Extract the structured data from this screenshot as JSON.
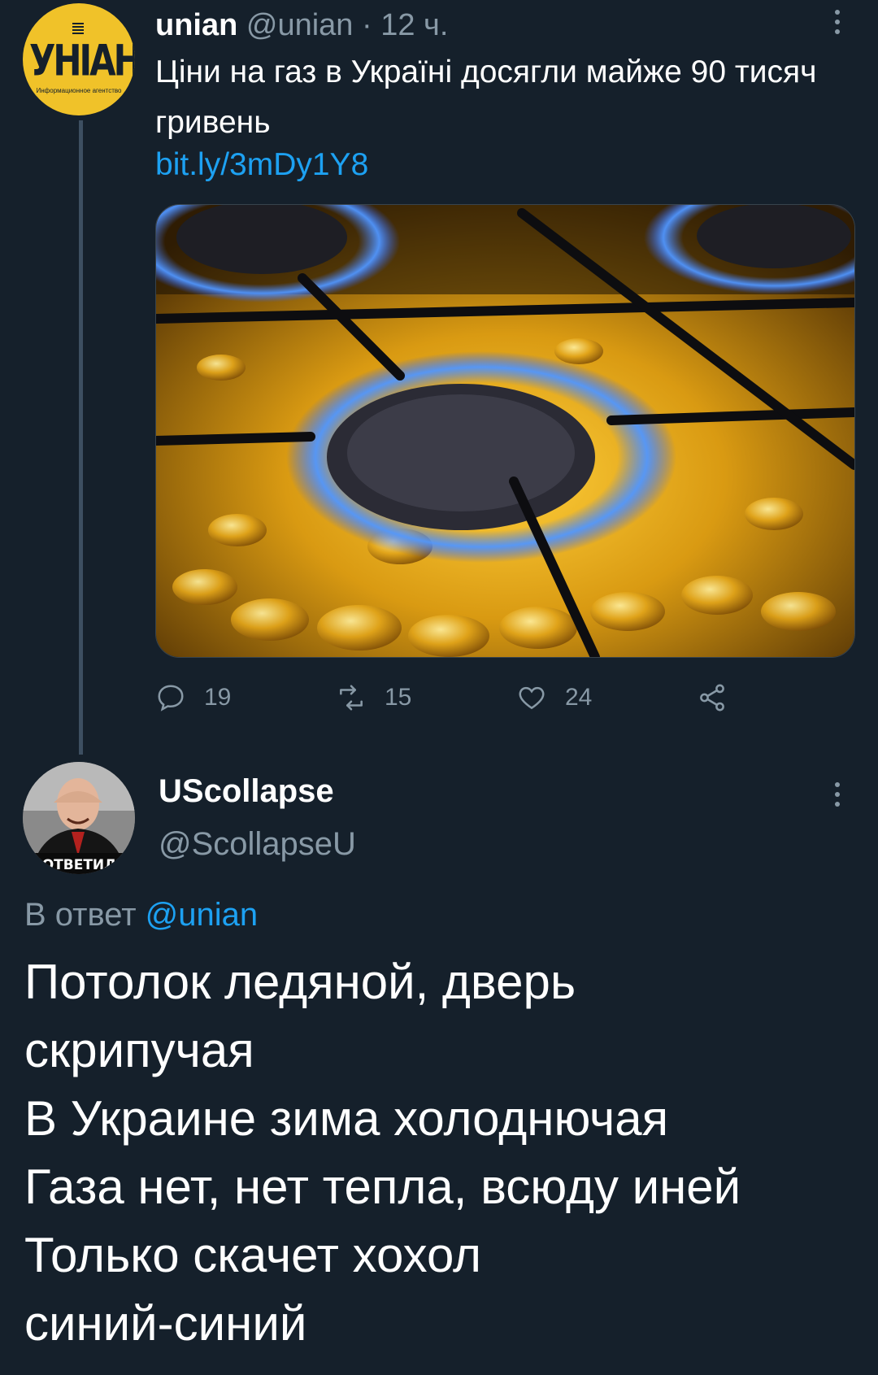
{
  "tweet1": {
    "avatar_label": "unian-logo",
    "avatar_logo_text": "УНІАН",
    "avatar_sub_text": "Информационное агентство",
    "name": "unian",
    "handle": "@unian",
    "separator": " · ",
    "time": "12 ч.",
    "text": "Ціни на газ в Україні досягли майже 90 тисяч гривень",
    "link": "bit.ly/3mDy1Y8",
    "media_description": "gas-burner-over-gold-coins",
    "stats": {
      "replies": "19",
      "retweets": "15",
      "likes": "24"
    }
  },
  "tweet2": {
    "name": "UScollapse",
    "handle": "@ScollapseU",
    "reply_prefix": "В ответ",
    "reply_mention": "@unian",
    "text": "Потолок ледяной, дверь\nскрипучая\nВ Украине зима холоднючая\nГаза нет, нет тепла, всюду иней\nТолько скачет хохол\nсиний-синий",
    "avatar_caption": "ОТВЕТИЛ"
  },
  "colors": {
    "background": "#15202b",
    "secondary_text": "#8899a6",
    "link": "#1da1f2",
    "thread_line": "#3d4f61",
    "logo_yellow": "#f0c229"
  }
}
